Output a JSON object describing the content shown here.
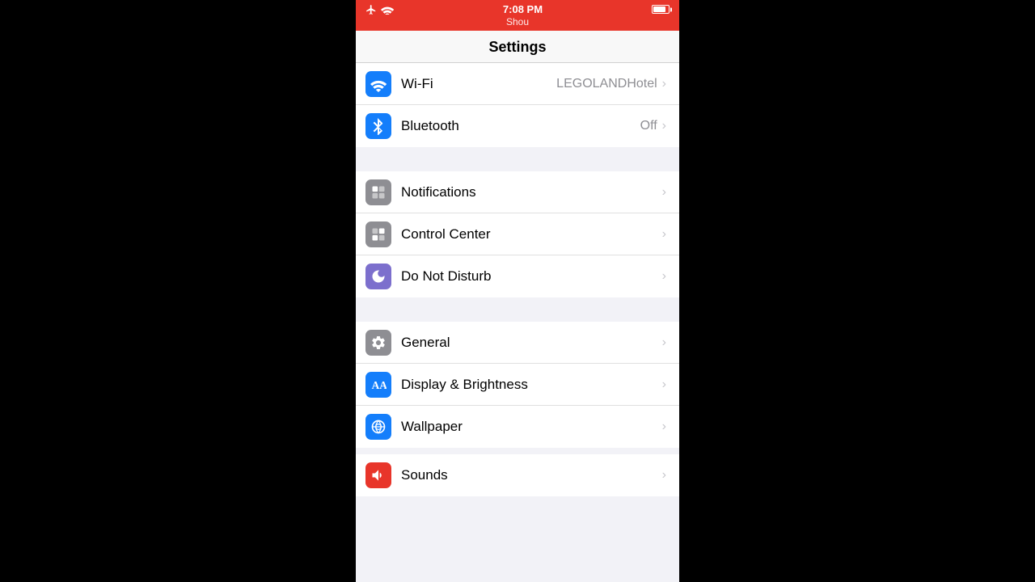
{
  "statusBar": {
    "time": "7:08 PM",
    "label": "Shou",
    "battery": "full"
  },
  "navBar": {
    "title": "Settings"
  },
  "sections": [
    {
      "id": "connectivity",
      "rows": [
        {
          "id": "wifi",
          "label": "Wi-Fi",
          "value": "LEGOLANDHotel",
          "iconColor": "#147efb",
          "iconType": "wifi"
        },
        {
          "id": "bluetooth",
          "label": "Bluetooth",
          "value": "Off",
          "iconColor": "#147efb",
          "iconType": "bluetooth"
        }
      ]
    },
    {
      "id": "system",
      "rows": [
        {
          "id": "notifications",
          "label": "Notifications",
          "value": "",
          "iconColor": "#8e8e93",
          "iconType": "notifications"
        },
        {
          "id": "control-center",
          "label": "Control Center",
          "value": "",
          "iconColor": "#8e8e93",
          "iconType": "control"
        },
        {
          "id": "do-not-disturb",
          "label": "Do Not Disturb",
          "value": "",
          "iconColor": "#7c6fcd",
          "iconType": "donotdisturb"
        }
      ]
    },
    {
      "id": "preferences",
      "rows": [
        {
          "id": "general",
          "label": "General",
          "value": "",
          "iconColor": "#8e8e93",
          "iconType": "general"
        },
        {
          "id": "display",
          "label": "Display & Brightness",
          "value": "",
          "iconColor": "#147efb",
          "iconType": "display"
        },
        {
          "id": "wallpaper",
          "label": "Wallpaper",
          "value": "",
          "iconColor": "#147efb",
          "iconType": "wallpaper"
        }
      ]
    }
  ]
}
